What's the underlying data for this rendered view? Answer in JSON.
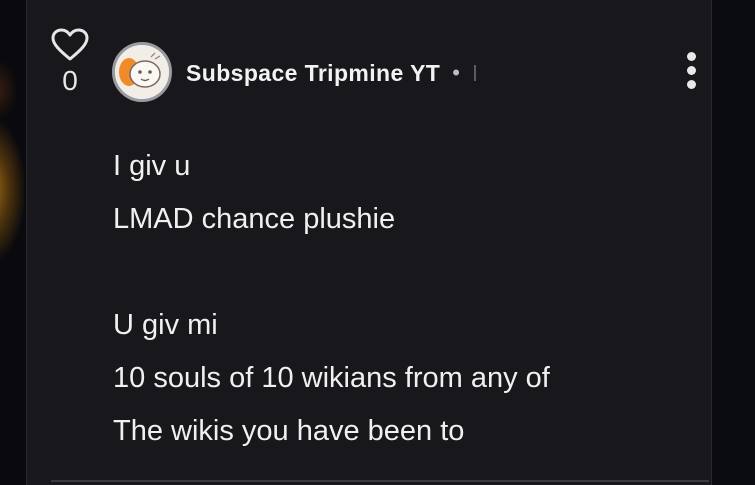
{
  "post": {
    "likes": "0",
    "author": "Subspace Tripmine YT",
    "separator": "•",
    "lines": [
      "I giv u",
      "LMAD chance plushie",
      "",
      "U giv mi",
      "10 souls of 10 wikians from any of",
      "The wikis you have been to"
    ]
  },
  "icons": {
    "like": "heart-outline-icon",
    "menu": "more-vertical-icon"
  },
  "colors": {
    "background": "#0b0c12",
    "card": "#17171c",
    "text": "#f0f0f0"
  }
}
